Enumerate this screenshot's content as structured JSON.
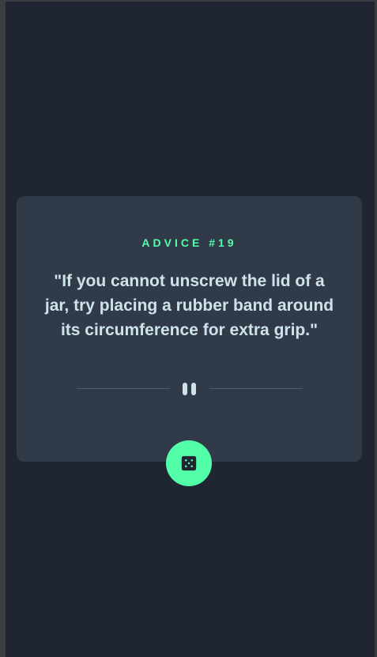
{
  "advice": {
    "label": "ADVICE #19",
    "quote": "\"If you cannot unscrew the lid of a jar, try placing a rubber band around its circumference for extra grip.\""
  },
  "divider": {
    "icon": "pause-icon"
  },
  "dice_button": {
    "icon": "dice-icon"
  },
  "colors": {
    "page_background": "#1f2632",
    "card_background": "#313a49",
    "accent": "#52ffa8",
    "quote_text": "#cee3e9",
    "divider_line": "#4f5d74"
  }
}
